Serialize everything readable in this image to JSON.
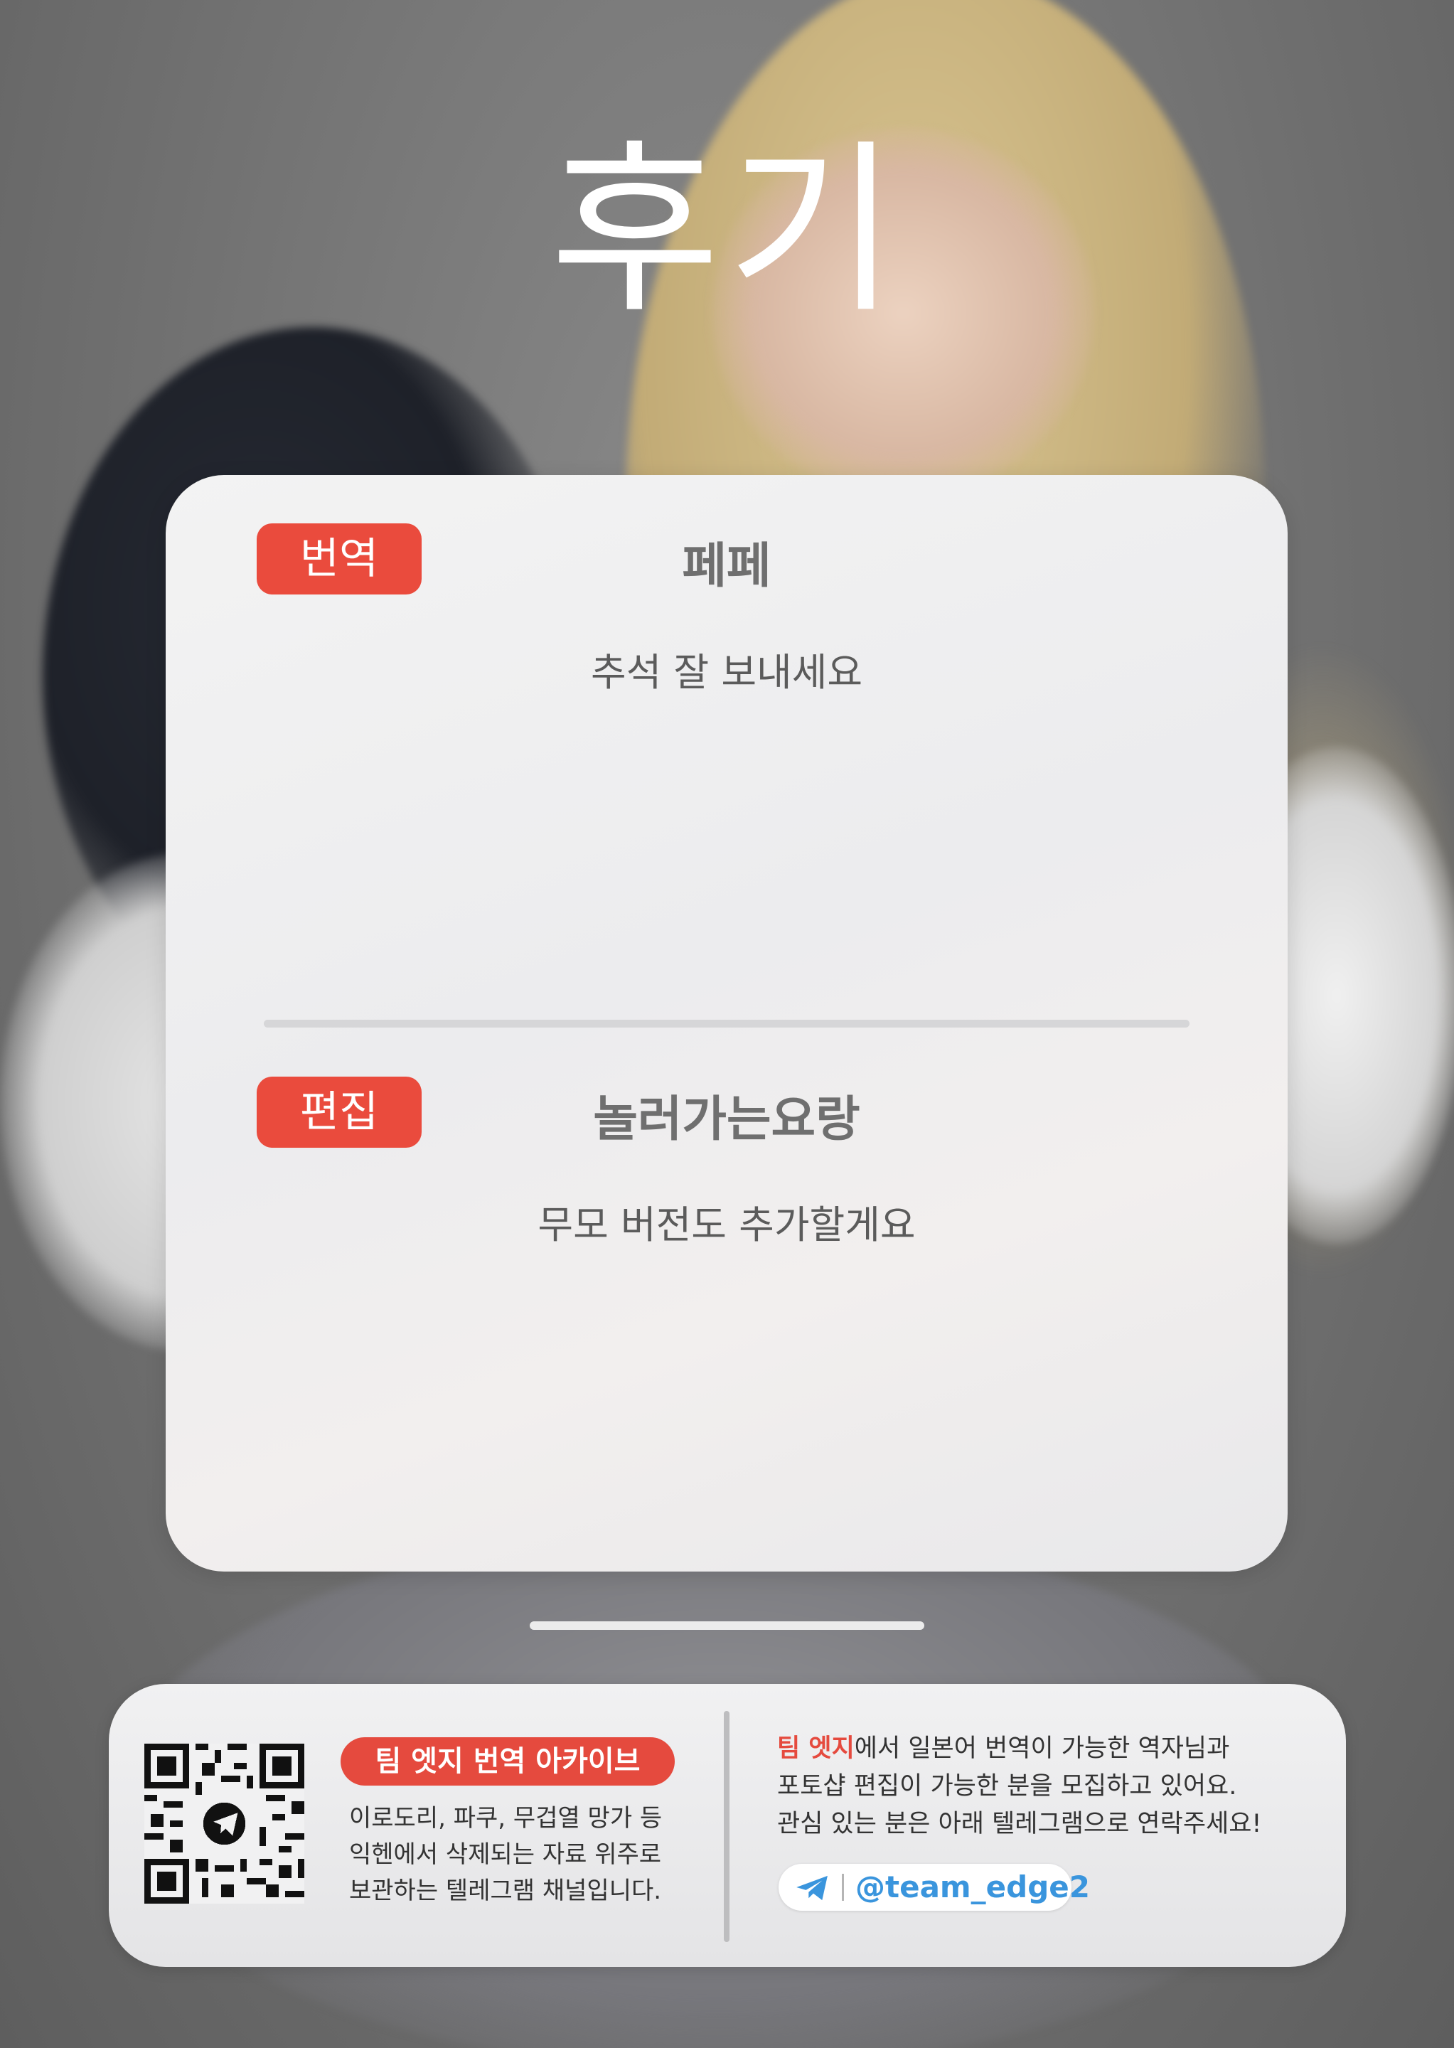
{
  "header": {
    "title": "후기"
  },
  "card": {
    "sections": [
      {
        "role": "번역",
        "name": "페페",
        "message": "추석 잘 보내세요"
      },
      {
        "role": "편집",
        "name": "놀러가는요랑",
        "message": "무모 버전도 추가할게요"
      }
    ]
  },
  "footer": {
    "archive": {
      "title": "팀 엣지 번역 아카이브",
      "lines": [
        "이로도리, 파쿠, 무겁열 망가 등",
        "익헨에서 삭제되는 자료 위주로",
        "보관하는 텔레그램 채널입니다."
      ]
    },
    "recruit": {
      "team_name": "팀 엣지",
      "line1_rest": "에서 일본어 번역이 가능한 역자님과",
      "line2": "포토샵 편집이 가능한 분을 모집하고 있어요.",
      "line3": "관심 있는 분은 아래 텔레그램으로 연락주세요!"
    },
    "telegram": {
      "icon": "telegram-icon",
      "handle": "@team_edge2"
    }
  },
  "colors": {
    "accent": "#ea4b3d",
    "telegram": "#3a95dd"
  }
}
